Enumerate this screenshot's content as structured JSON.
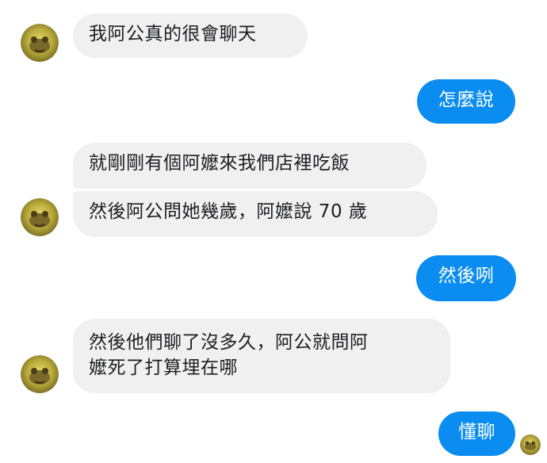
{
  "chat": {
    "messages": [
      {
        "sender": "other",
        "text": "我阿公真的很會聊天"
      },
      {
        "sender": "self",
        "text": "怎麼說"
      },
      {
        "sender": "other",
        "text": "就剛剛有個阿嬤來我們店裡吃飯"
      },
      {
        "sender": "other",
        "text": "然後阿公問她幾歲，阿嬤說 70 歲"
      },
      {
        "sender": "self",
        "text": "然後咧"
      },
      {
        "sender": "other",
        "lines": [
          "然後他們聊了沒多久，阿公就問阿",
          "嬤死了打算埋在哪"
        ]
      },
      {
        "sender": "self",
        "text": "懂聊"
      }
    ]
  },
  "colors": {
    "incoming_bubble": "#f1f0f0",
    "outgoing_bubble": "#0a8cf0",
    "incoming_text": "#1c1e21",
    "outgoing_text": "#ffffff"
  },
  "icons": {
    "avatar": "contact-avatar-icon",
    "read_receipt": "read-receipt-avatar-icon"
  }
}
